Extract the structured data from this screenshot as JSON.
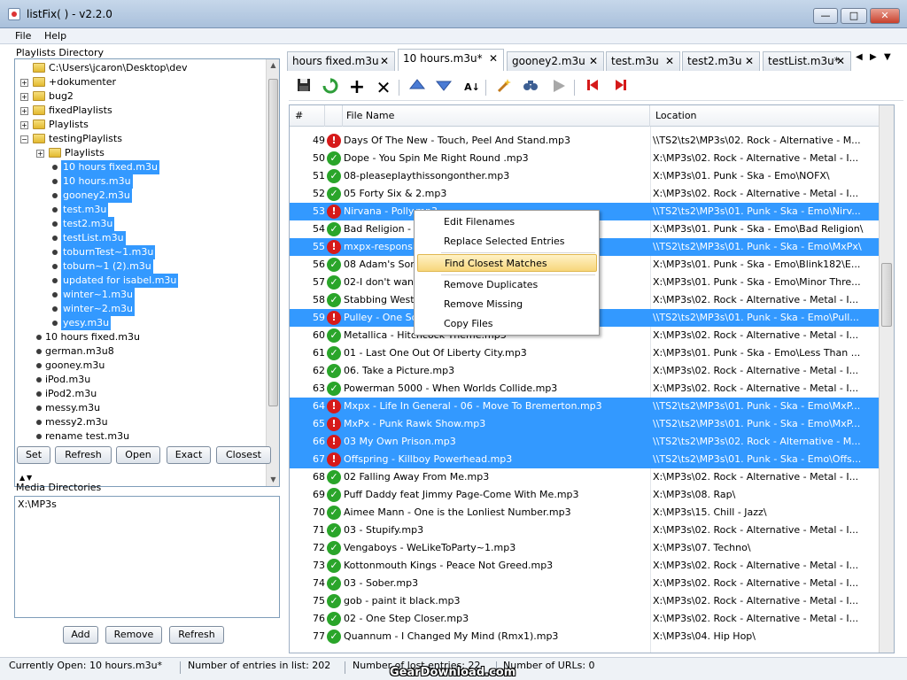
{
  "window": {
    "title": "listFix( ) - v2.2.0",
    "min": "—",
    "max": "□",
    "close": "✕"
  },
  "menu": [
    "File",
    "Help"
  ],
  "playlists_directory": {
    "title": "Playlists Directory",
    "tree": [
      {
        "label": "C:\\Users\\jcaron\\Desktop\\dev",
        "kind": "folder",
        "level": 0,
        "exp": ""
      },
      {
        "label": "+dokumenter",
        "kind": "folder",
        "level": 1,
        "exp": "+"
      },
      {
        "label": "bug2",
        "kind": "folder",
        "level": 1,
        "exp": "+"
      },
      {
        "label": "fixedPlaylists",
        "kind": "folder",
        "level": 1,
        "exp": "+"
      },
      {
        "label": "Playlists",
        "kind": "folder",
        "level": 1,
        "exp": "+"
      },
      {
        "label": "testingPlaylists",
        "kind": "folder",
        "level": 1,
        "exp": "−"
      },
      {
        "label": "Playlists",
        "kind": "folder",
        "level": 2,
        "exp": "+"
      },
      {
        "label": "10 hours fixed.m3u",
        "kind": "file",
        "level": 2,
        "sel": true
      },
      {
        "label": "10 hours.m3u",
        "kind": "file",
        "level": 2,
        "sel": true
      },
      {
        "label": "gooney2.m3u",
        "kind": "file",
        "level": 2,
        "sel": true
      },
      {
        "label": "test.m3u",
        "kind": "file",
        "level": 2,
        "sel": true
      },
      {
        "label": "test2.m3u",
        "kind": "file",
        "level": 2,
        "sel": true
      },
      {
        "label": "testList.m3u",
        "kind": "file",
        "level": 2,
        "sel": true
      },
      {
        "label": "toburnTest~1.m3u",
        "kind": "file",
        "level": 2,
        "sel": true
      },
      {
        "label": "toburn~1 (2).m3u",
        "kind": "file",
        "level": 2,
        "sel": true
      },
      {
        "label": "updated for isabel.m3u",
        "kind": "file",
        "level": 2,
        "sel": true
      },
      {
        "label": "winter~1.m3u",
        "kind": "file",
        "level": 2,
        "sel": true
      },
      {
        "label": "winter~2.m3u",
        "kind": "file",
        "level": 2,
        "sel": true
      },
      {
        "label": "yesy.m3u",
        "kind": "file",
        "level": 2,
        "sel": true
      },
      {
        "label": "10 hours fixed.m3u",
        "kind": "file",
        "level": 1
      },
      {
        "label": "german.m3u8",
        "kind": "file",
        "level": 1
      },
      {
        "label": "gooney.m3u",
        "kind": "file",
        "level": 1
      },
      {
        "label": "iPod.m3u",
        "kind": "file",
        "level": 1
      },
      {
        "label": "iPod2.m3u",
        "kind": "file",
        "level": 1
      },
      {
        "label": "messy.m3u",
        "kind": "file",
        "level": 1
      },
      {
        "label": "messy2.m3u",
        "kind": "file",
        "level": 1
      },
      {
        "label": "rename test.m3u",
        "kind": "file",
        "level": 1
      }
    ],
    "buttons": [
      "Set",
      "Refresh",
      "Open",
      "Exact",
      "Closest"
    ]
  },
  "media_directories": {
    "title": "Media Directories",
    "items": [
      "X:\\MP3s"
    ],
    "buttons": [
      "Add",
      "Remove",
      "Refresh"
    ]
  },
  "tabs": [
    {
      "label": "hours fixed.m3u",
      "close": "✕"
    },
    {
      "label": "10 hours.m3u*",
      "close": "✕",
      "active": true
    },
    {
      "label": "gooney2.m3u",
      "close": "✕"
    },
    {
      "label": "test.m3u",
      "close": "✕"
    },
    {
      "label": "test2.m3u",
      "close": "✕"
    },
    {
      "label": "testList.m3u*",
      "close": "✕"
    }
  ],
  "tab_nav": [
    "◀",
    "▶",
    "▼"
  ],
  "toolbar": {
    "icons": [
      "save-icon",
      "reload-icon",
      "add-icon",
      "delete-icon",
      "move-up-icon",
      "move-down-icon",
      "sort-icon",
      "magic-wand-icon",
      "find-icon",
      "play-icon",
      "first-icon",
      "last-icon"
    ]
  },
  "table": {
    "columns": [
      "#",
      "File Name",
      "Location"
    ],
    "rows": [
      {
        "n": "49",
        "ok": false,
        "file": "Days Of The New - Touch, Peel And Stand.mp3",
        "loc": "\\\\TS2\\ts2\\MP3s\\02. Rock - Alternative - M...",
        "sel": false
      },
      {
        "n": "50",
        "ok": true,
        "file": "Dope - You Spin Me Right Round .mp3",
        "loc": "X:\\MP3s\\02. Rock - Alternative - Metal - I...",
        "sel": false
      },
      {
        "n": "51",
        "ok": true,
        "file": "08-pleaseplaythissongonther.mp3",
        "loc": "X:\\MP3s\\01. Punk - Ska - Emo\\NOFX\\",
        "sel": false
      },
      {
        "n": "52",
        "ok": true,
        "file": "05 Forty Six & 2.mp3",
        "loc": "X:\\MP3s\\02. Rock - Alternative - Metal - I...",
        "sel": false
      },
      {
        "n": "53",
        "ok": false,
        "file": "Nirvana - Polly.mp3",
        "loc": "\\\\TS2\\ts2\\MP3s\\01. Punk - Ska - Emo\\Nirv...",
        "sel": true
      },
      {
        "n": "54",
        "ok": true,
        "file": "Bad Religion - ...",
        "loc": "X:\\MP3s\\01. Punk - Ska - Emo\\Bad Religion\\",
        "sel": false
      },
      {
        "n": "55",
        "ok": false,
        "file": "mxpx-responsibility.mp3",
        "loc": "\\\\TS2\\ts2\\MP3s\\01. Punk - Ska - Emo\\MxPx\\",
        "sel": true
      },
      {
        "n": "56",
        "ok": true,
        "file": "08 Adam's Song.mp3",
        "loc": "X:\\MP3s\\01. Punk - Ska - Emo\\Blink182\\E...",
        "sel": false
      },
      {
        "n": "57",
        "ok": true,
        "file": "02-I don't wanna.mp3",
        "loc": "X:\\MP3s\\01. Punk - Ska - Emo\\Minor Thre...",
        "sel": false
      },
      {
        "n": "58",
        "ok": true,
        "file": "Stabbing Westward.mp3",
        "loc": "X:\\MP3s\\02. Rock - Alternative - Metal - I...",
        "sel": false
      },
      {
        "n": "59",
        "ok": false,
        "file": "Pulley - One Song.mp3",
        "loc": "\\\\TS2\\ts2\\MP3s\\01. Punk - Ska - Emo\\Pull...",
        "sel": true
      },
      {
        "n": "60",
        "ok": true,
        "file": "Metallica - Hitchcock Theme.mp3",
        "loc": "X:\\MP3s\\02. Rock - Alternative - Metal - I...",
        "sel": false
      },
      {
        "n": "61",
        "ok": true,
        "file": "01 - Last One Out Of Liberty City.mp3",
        "loc": "X:\\MP3s\\01. Punk - Ska - Emo\\Less Than ...",
        "sel": false
      },
      {
        "n": "62",
        "ok": true,
        "file": "06. Take a Picture.mp3",
        "loc": "X:\\MP3s\\02. Rock - Alternative - Metal - I...",
        "sel": false
      },
      {
        "n": "63",
        "ok": true,
        "file": "Powerman 5000 - When Worlds Collide.mp3",
        "loc": "X:\\MP3s\\02. Rock - Alternative - Metal - I...",
        "sel": false
      },
      {
        "n": "64",
        "ok": false,
        "file": "Mxpx - Life In General - 06 - Move To Bremerton.mp3",
        "loc": "\\\\TS2\\ts2\\MP3s\\01. Punk - Ska - Emo\\MxP...",
        "sel": true
      },
      {
        "n": "65",
        "ok": false,
        "file": "MxPx - Punk Rawk Show.mp3",
        "loc": "\\\\TS2\\ts2\\MP3s\\01. Punk - Ska - Emo\\MxP...",
        "sel": true
      },
      {
        "n": "66",
        "ok": false,
        "file": "03 My Own Prison.mp3",
        "loc": "\\\\TS2\\ts2\\MP3s\\02. Rock - Alternative - M...",
        "sel": true
      },
      {
        "n": "67",
        "ok": false,
        "file": "Offspring - Killboy Powerhead.mp3",
        "loc": "\\\\TS2\\ts2\\MP3s\\01. Punk - Ska - Emo\\Offs...",
        "sel": true
      },
      {
        "n": "68",
        "ok": true,
        "file": "02 Falling Away From Me.mp3",
        "loc": "X:\\MP3s\\02. Rock - Alternative - Metal - I...",
        "sel": false
      },
      {
        "n": "69",
        "ok": true,
        "file": "Puff Daddy feat Jimmy Page-Come With Me.mp3",
        "loc": "X:\\MP3s\\08. Rap\\",
        "sel": false
      },
      {
        "n": "70",
        "ok": true,
        "file": "Aimee Mann - One is the Lonliest Number.mp3",
        "loc": "X:\\MP3s\\15. Chill - Jazz\\",
        "sel": false
      },
      {
        "n": "71",
        "ok": true,
        "file": "03 - Stupify.mp3",
        "loc": "X:\\MP3s\\02. Rock - Alternative - Metal - I...",
        "sel": false
      },
      {
        "n": "72",
        "ok": true,
        "file": "Vengaboys - WeLikeToParty~1.mp3",
        "loc": "X:\\MP3s\\07. Techno\\",
        "sel": false
      },
      {
        "n": "73",
        "ok": true,
        "file": "Kottonmouth Kings - Peace Not Greed.mp3",
        "loc": "X:\\MP3s\\02. Rock - Alternative - Metal - I...",
        "sel": false
      },
      {
        "n": "74",
        "ok": true,
        "file": "03 - Sober.mp3",
        "loc": "X:\\MP3s\\02. Rock - Alternative - Metal - I...",
        "sel": false
      },
      {
        "n": "75",
        "ok": true,
        "file": "gob - paint it black.mp3",
        "loc": "X:\\MP3s\\02. Rock - Alternative - Metal - I...",
        "sel": false
      },
      {
        "n": "76",
        "ok": true,
        "file": "02 - One Step Closer.mp3",
        "loc": "X:\\MP3s\\02. Rock - Alternative - Metal - I...",
        "sel": false
      },
      {
        "n": "77",
        "ok": true,
        "file": "Quannum - I Changed My Mind (Rmx1).mp3",
        "loc": "X:\\MP3s\\04. Hip Hop\\",
        "sel": false
      }
    ]
  },
  "context_menu": {
    "groups": [
      [
        "Edit Filenames",
        "Replace Selected Entries"
      ],
      [
        "Find Closest Matches"
      ],
      [
        "Remove Duplicates",
        "Remove Missing",
        "Copy Files"
      ]
    ],
    "highlighted": "Find Closest Matches"
  },
  "status": {
    "current": "Currently Open: 10 hours.m3u*",
    "entries": "Number of entries in list: 202",
    "lost": "Number of lost entries: 22",
    "urls": "Number of URLs: 0"
  },
  "watermark": "GearDownload.com"
}
